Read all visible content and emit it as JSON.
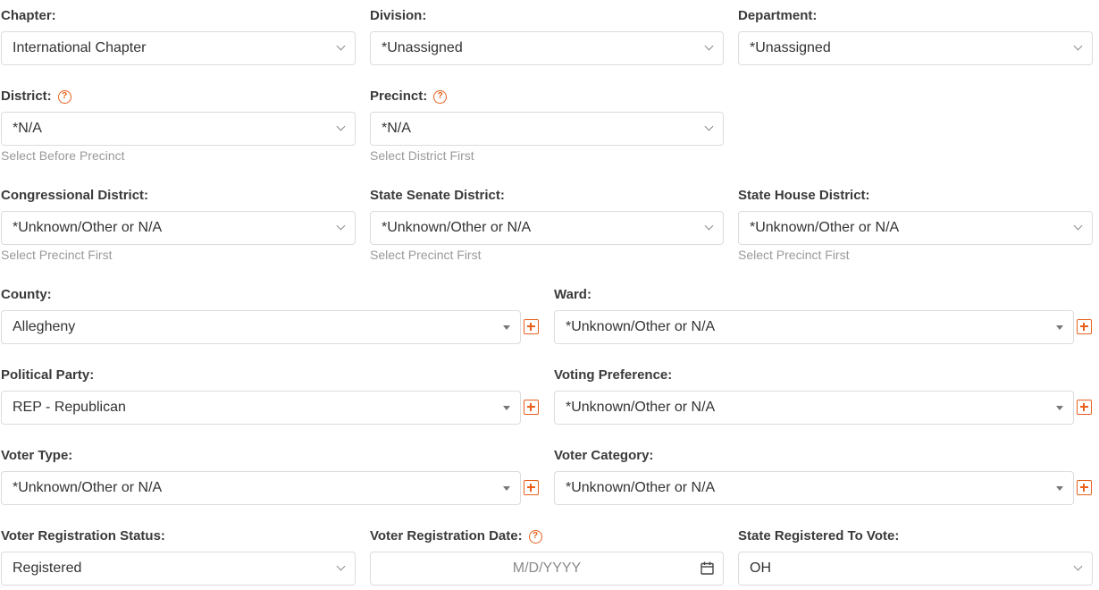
{
  "form": {
    "chapter": {
      "label": "Chapter:",
      "value": "International Chapter"
    },
    "division": {
      "label": "Division:",
      "value": "*Unassigned"
    },
    "department": {
      "label": "Department:",
      "value": "*Unassigned"
    },
    "district": {
      "label": "District:",
      "value": "*N/A",
      "hint": "Select Before Precinct"
    },
    "precinct": {
      "label": "Precinct:",
      "value": "*N/A",
      "hint": "Select District First"
    },
    "congressional_district": {
      "label": "Congressional District:",
      "value": "*Unknown/Other or N/A",
      "hint": "Select Precinct First"
    },
    "state_senate_district": {
      "label": "State Senate District:",
      "value": "*Unknown/Other or N/A",
      "hint": "Select Precinct First"
    },
    "state_house_district": {
      "label": "State House District:",
      "value": "*Unknown/Other or N/A",
      "hint": "Select Precinct First"
    },
    "county": {
      "label": "County:",
      "value": "Allegheny"
    },
    "ward": {
      "label": "Ward:",
      "value": "*Unknown/Other or N/A"
    },
    "political_party": {
      "label": "Political Party:",
      "value": "REP - Republican"
    },
    "voting_preference": {
      "label": "Voting Preference:",
      "value": "*Unknown/Other or N/A"
    },
    "voter_type": {
      "label": "Voter Type:",
      "value": "*Unknown/Other or N/A"
    },
    "voter_category": {
      "label": "Voter Category:",
      "value": "*Unknown/Other or N/A"
    },
    "voter_registration_status": {
      "label": "Voter Registration Status:",
      "value": "Registered"
    },
    "voter_registration_date": {
      "label": "Voter Registration Date:",
      "placeholder": "M/D/YYYY"
    },
    "state_registered_to_vote": {
      "label": "State Registered To Vote:",
      "value": "OH"
    }
  },
  "icons": {
    "help": "question-circle-icon",
    "add": "plus-square-icon",
    "dropdown": "chevron-down-icon",
    "calendar": "calendar-icon"
  },
  "colors": {
    "accent": "#e8601c",
    "hint_text": "#9a9a9a",
    "border": "#dcdcdc"
  }
}
